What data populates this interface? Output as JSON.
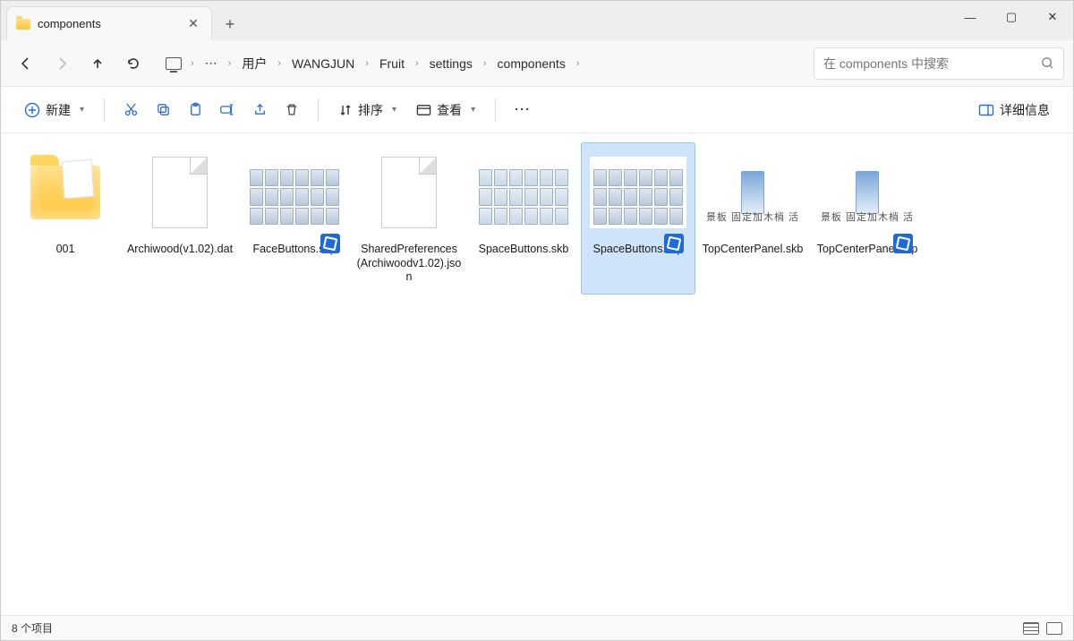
{
  "tab": {
    "title": "components"
  },
  "window_controls": {
    "minimize": "—",
    "maximize": "▢",
    "close": "✕"
  },
  "breadcrumb": {
    "parts": [
      "用户",
      "WANGJUN",
      "Fruit",
      "settings",
      "components"
    ],
    "ellipsis": "⋯"
  },
  "search": {
    "placeholder": "在 components 中搜索"
  },
  "toolbar": {
    "new_label": "新建",
    "sort_label": "排序",
    "view_label": "查看",
    "details_label": "详细信息"
  },
  "items": [
    {
      "name": "001",
      "kind": "folder"
    },
    {
      "name": "Archiwood(v1.02).dat",
      "kind": "file"
    },
    {
      "name": "FaceButtons.skp",
      "kind": "skp"
    },
    {
      "name": "SharedPreferences(Archiwoodv1.02).json",
      "kind": "file"
    },
    {
      "name": "SpaceButtons.skb",
      "kind": "skb"
    },
    {
      "name": "SpaceButtons.skp",
      "kind": "skp",
      "selected": true
    },
    {
      "name": "TopCenterPanel.skb",
      "kind": "panel"
    },
    {
      "name": "TopCenterPanel.skp",
      "kind": "panel_skp"
    }
  ],
  "status": {
    "text": "8 个项目"
  }
}
